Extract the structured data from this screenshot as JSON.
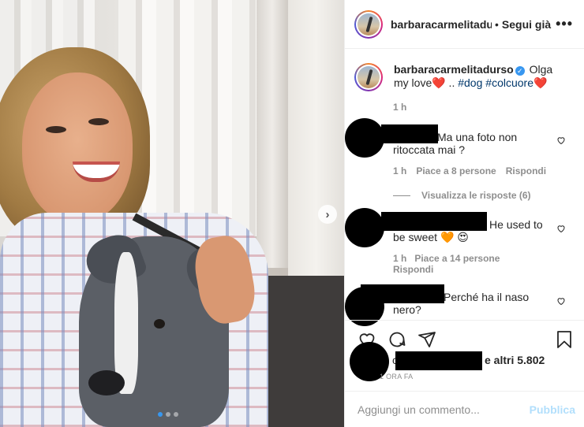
{
  "header": {
    "username": "barbaracarmelitadurso",
    "separator": "•",
    "follow_label": "Segui già",
    "more_icon": "more-options-icon",
    "more_label": "•••"
  },
  "photo": {
    "next_icon": "chevron-right-icon",
    "next_label": "›",
    "carousel_count": 3,
    "carousel_active": 1
  },
  "caption": {
    "username": "barbaracarmelitadurso",
    "verified_icon": "verified-badge-icon",
    "verified_label": "✓",
    "text": "Olga my love",
    "heart1": "❤️",
    "mid": " .. ",
    "tag1": "#dog",
    "tag2": "#colcuore",
    "heart2": "❤️",
    "time": "1 h"
  },
  "comments": [
    {
      "text": "Ma una foto non ritoccata mai ?",
      "time": "1 h",
      "likes": "Piace a 8 persone",
      "reply": "Rispondi",
      "like_icon": "heart-outline-icon"
    },
    {
      "text": "He used to be sweet",
      "emoji1": "🧡",
      "emoji2": "😍",
      "time": "1 h",
      "likes": "Piace a 14 persone",
      "reply": "Rispondi",
      "like_icon": "heart-outline-icon"
    },
    {
      "text": "Perché ha il naso nero?",
      "like_icon": "heart-outline-icon"
    }
  ],
  "view_replies": "Visualizza le risposte (6)",
  "actions": {
    "like_icon": "heart-outline-icon",
    "comment_icon": "comment-icon",
    "share_icon": "share-icon",
    "save_icon": "bookmark-icon"
  },
  "likes": {
    "prefix": "e",
    "text": "e altri 5.802"
  },
  "post_time": "1 ORA FA",
  "add_comment": {
    "placeholder": "Aggiungi un commento...",
    "publish_label": "Pubblica"
  },
  "colors": {
    "accent": "#3797f0",
    "publish_disabled": "#b2dffc",
    "muted": "#8e8e8e",
    "text": "#262626"
  }
}
